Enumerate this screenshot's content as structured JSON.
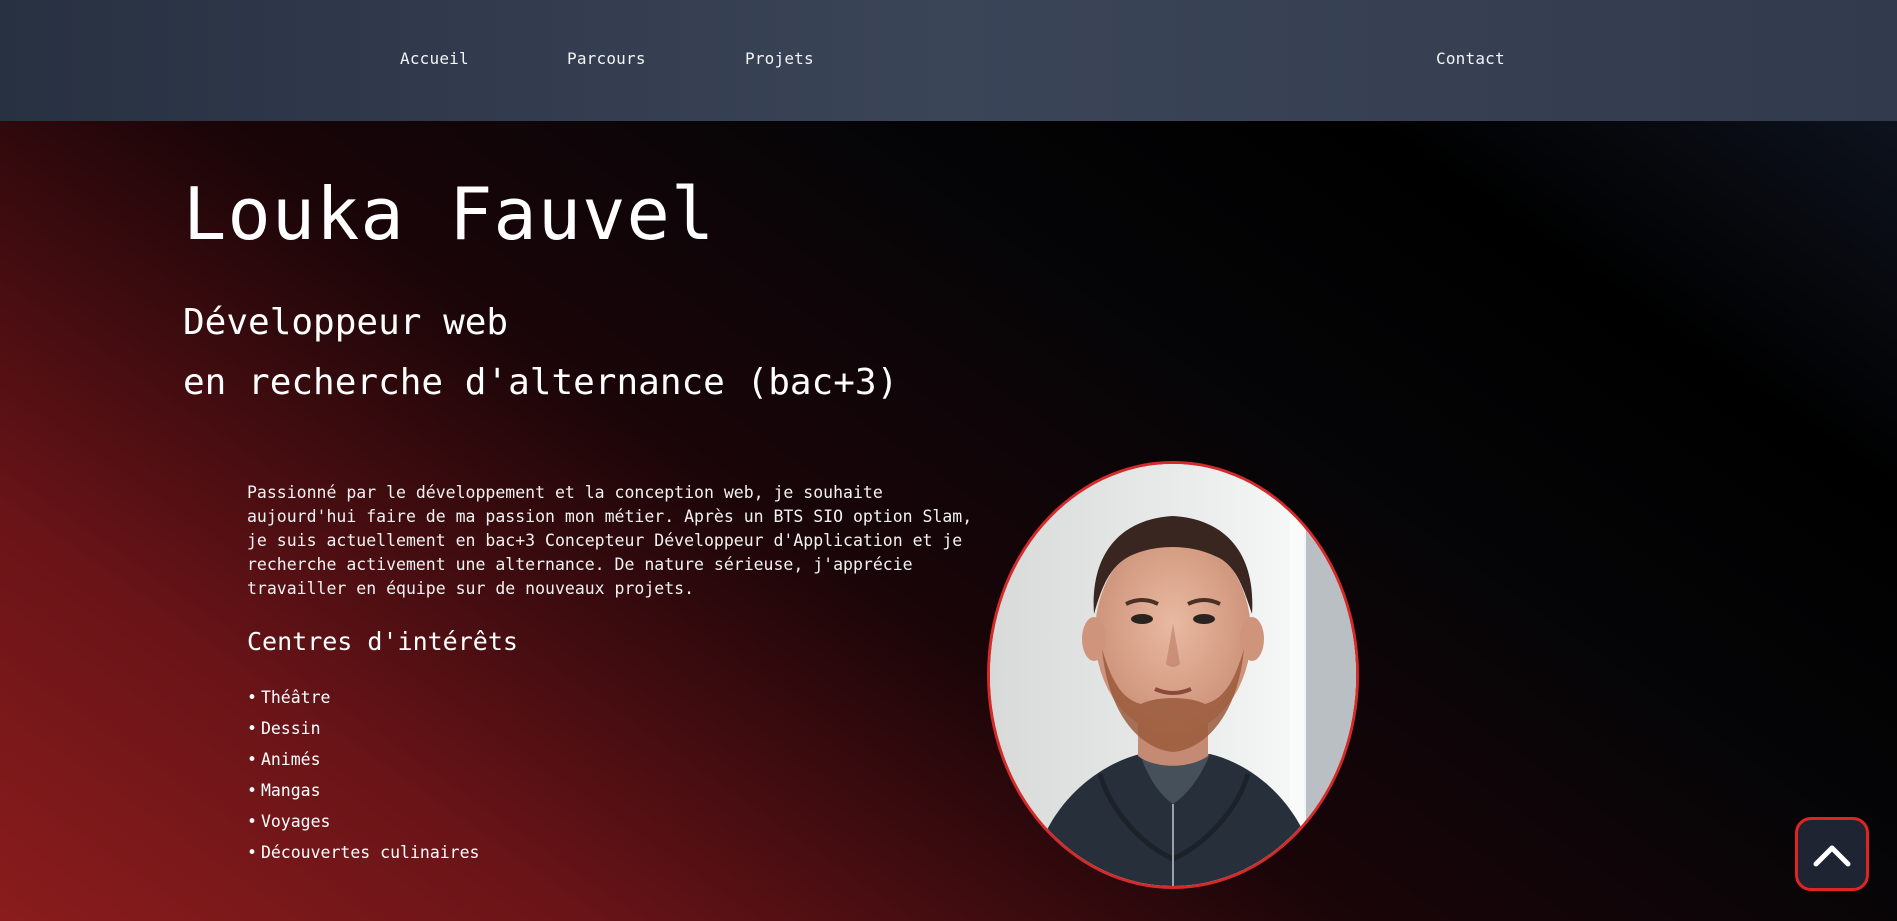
{
  "nav": {
    "items": [
      {
        "label": "Accueil"
      },
      {
        "label": "Parcours"
      },
      {
        "label": "Projets"
      }
    ],
    "contact_label": "Contact"
  },
  "hero": {
    "name": "Louka Fauvel",
    "role_line1": "Développeur web",
    "role_line2": "en recherche d'alternance (bac+3)"
  },
  "about": {
    "bio": "Passionné par le développement et la conception web, je souhaite aujourd'hui faire de ma passion mon métier. Après un BTS SIO option Slam, je suis actuellement en bac+3 Concepteur Développeur d'Application et je recherche activement une alternance. De nature sérieuse, j'apprécie travailler en équipe sur de nouveaux projets.",
    "interests_title": "Centres d'intérêts",
    "interests": [
      "Théâtre",
      "Dessin",
      "Animés",
      "Mangas",
      "Voyages",
      "Découvertes culinaires"
    ]
  },
  "photo": {
    "icon": "profile-photo",
    "border_color": "#d42a2a"
  },
  "scroll_top": {
    "icon": "chevron-up-icon",
    "border_color": "#e02424"
  }
}
